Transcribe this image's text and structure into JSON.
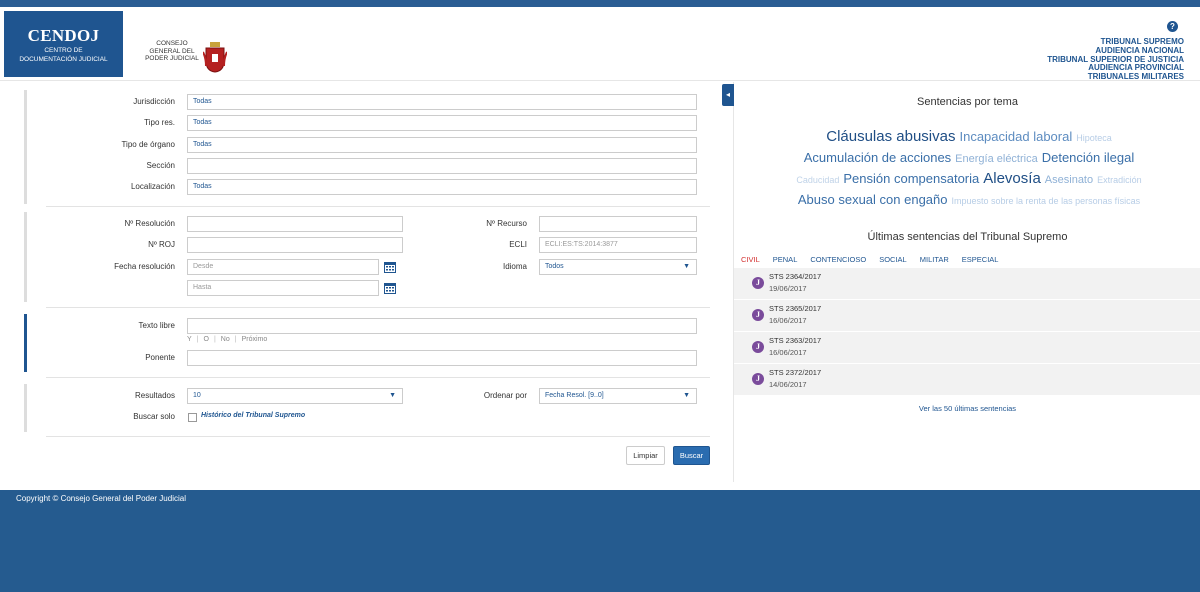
{
  "header": {
    "logo_title": "CENDOJ",
    "logo_line1": "CENTRO DE",
    "logo_line2": "DOCUMENTACIÓN JUDICIAL",
    "cgpj_line1": "Consejo",
    "cgpj_line2": "General del",
    "cgpj_line3": "Poder Judicial",
    "help_label": "?",
    "courts": [
      "TRIBUNAL SUPREMO",
      "AUDIENCIA NACIONAL",
      "TRIBUNAL SUPERIOR DE JUSTICIA",
      "AUDIENCIA PROVINCIAL",
      "TRIBUNALES MILITARES"
    ]
  },
  "form": {
    "jurisdiccion_label": "Jurisdicción",
    "jurisdiccion_value": "Todas",
    "tipo_res_label": "Tipo res.",
    "tipo_res_value": "Todas",
    "tipo_organo_label": "Tipo de órgano",
    "tipo_organo_value": "Todas",
    "seccion_label": "Sección",
    "seccion_value": "",
    "localizacion_label": "Localización",
    "localizacion_value": "Todas",
    "n_resolucion_label": "Nº Resolución",
    "n_recurso_label": "Nº Recurso",
    "n_roj_label": "Nº ROJ",
    "ecli_label": "ECLI",
    "ecli_placeholder": "ECLI:ES:TS:2014:3877",
    "fecha_label": "Fecha resolución",
    "desde_placeholder": "Desde",
    "hasta_placeholder": "Hasta",
    "idioma_label": "Idioma",
    "idioma_value": "Todos",
    "texto_libre_label": "Texto libre",
    "ops": [
      "Y",
      "O",
      "No",
      "Próximo"
    ],
    "ponente_label": "Ponente",
    "resultados_label": "Resultados",
    "resultados_value": "10",
    "ordenar_label": "Ordenar por",
    "ordenar_value": "Fecha Resol. [9..0]",
    "buscar_solo_label": "Buscar solo",
    "historico_label": "Histórico del Tribunal Supremo",
    "limpiar_label": "Limpiar",
    "buscar_label": "Buscar"
  },
  "right": {
    "collapse_label": "◂",
    "topics_title": "Sentencias por tema",
    "topics": [
      {
        "text": "Cláusulas abusivas",
        "color": "#1f4e85"
      },
      {
        "text": "Incapacidad laboral",
        "color": "#5d8cc0"
      },
      {
        "text": "Hipoteca",
        "color": "#b7cde6"
      },
      {
        "text": "Acumulación de acciones",
        "color": "#3a6fa8"
      },
      {
        "text": "Energía eléctrica",
        "color": "#8fb1d6"
      },
      {
        "text": "Detención ilegal",
        "color": "#3a6fa8"
      },
      {
        "text": "Caducidad",
        "color": "#c0d3e8"
      },
      {
        "text": "Pensión compensatoria",
        "color": "#3a6fa8"
      },
      {
        "text": "Alevosía",
        "color": "#1f4e85"
      },
      {
        "text": "Asesinato",
        "color": "#8fb1d6"
      },
      {
        "text": "Extradición",
        "color": "#b7cde6"
      },
      {
        "text": "Abuso sexual con engaño",
        "color": "#3a6fa8"
      },
      {
        "text": "Impuesto sobre la renta de las personas físicas",
        "color": "#b7cde6"
      }
    ],
    "latest_title": "Últimas sentencias del Tribunal Supremo",
    "tabs": [
      "CIVIL",
      "PENAL",
      "CONTENCIOSO",
      "SOCIAL",
      "MILITAR",
      "ESPECIAL"
    ],
    "sentences": [
      {
        "num": "STS 2364/2017",
        "date": "19/06/2017"
      },
      {
        "num": "STS 2365/2017",
        "date": "16/06/2017"
      },
      {
        "num": "STS 2363/2017",
        "date": "16/06/2017"
      },
      {
        "num": "STS 2372/2017",
        "date": "14/06/2017"
      }
    ],
    "icon_glyph": "J",
    "more_link": "Ver las 50 últimas sentencias"
  },
  "footer": {
    "copyright": "Copyright © Consejo General del Poder Judicial"
  }
}
